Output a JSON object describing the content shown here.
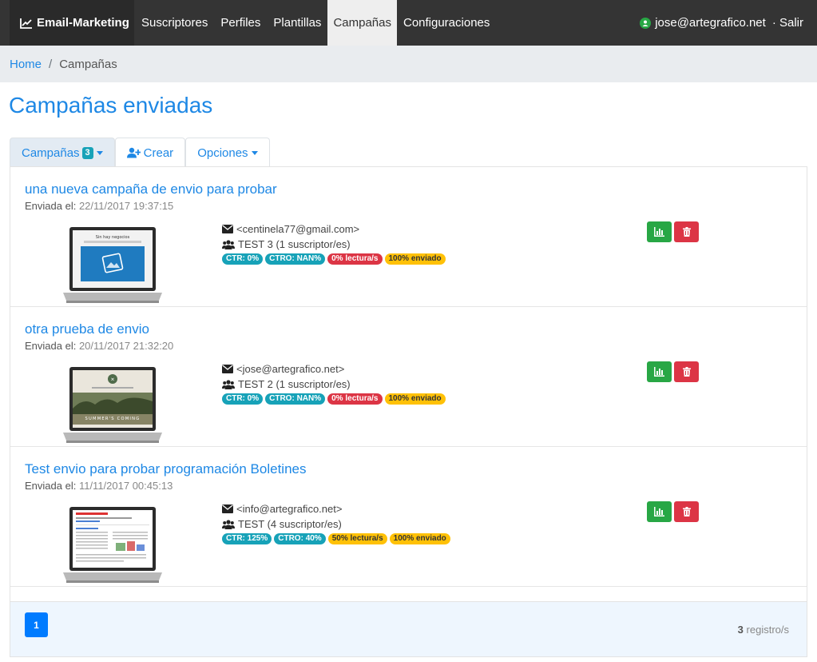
{
  "navbar": {
    "brand": "Email-Marketing",
    "items": [
      {
        "label": "Suscriptores"
      },
      {
        "label": "Perfiles"
      },
      {
        "label": "Plantillas"
      },
      {
        "label": "Campañas"
      },
      {
        "label": "Configuraciones"
      }
    ],
    "user_email": "jose@artegrafico.net",
    "logout_label": "· Salir"
  },
  "breadcrumb": {
    "home": "Home",
    "separator": "/",
    "current": "Campañas"
  },
  "page_title": "Campañas enviadas",
  "tabs": {
    "campaigns_label": "Campañas",
    "campaigns_count": "3",
    "create_label": "Crear",
    "options_label": "Opciones"
  },
  "campaigns": [
    {
      "title": "una nueva campaña de envio para probar",
      "date_label": "Enviada el:",
      "date": "22/11/2017 19:37:15",
      "email": "<centinela77@gmail.com>",
      "group": "TEST 3 (1 suscriptor/es)",
      "ctr": "CTR: 0%",
      "ctro": "CTRO: NAN%",
      "reading": "0% lectura/s",
      "sent": "100% enviado",
      "thumb_caption": "Sin hay negocios"
    },
    {
      "title": "otra prueba de envio",
      "date_label": "Enviada el:",
      "date": "20/11/2017 21:32:20",
      "email": "<jose@artegrafico.net>",
      "group": "TEST 2 (1 suscriptor/es)",
      "ctr": "CTR: 0%",
      "ctro": "CTRO: NAN%",
      "reading": "0% lectura/s",
      "sent": "100% enviado",
      "thumb_caption": "SUMMER'S COMING"
    },
    {
      "title": "Test envio para probar programación Boletines",
      "date_label": "Enviada el:",
      "date": "11/11/2017 00:45:13",
      "email": "<info@artegrafico.net>",
      "group": "TEST (4 suscriptor/es)",
      "ctr": "CTR: 125%",
      "ctro": "CTRO: 40%",
      "reading": "50% lectura/s",
      "sent": "100% enviado",
      "thumb_caption": ""
    }
  ],
  "pagination": {
    "current_page": "1",
    "records_count": "3",
    "records_label": "registro/s"
  },
  "colors": {
    "accent": "#1e88e5",
    "navbar": "#343434",
    "success": "#28a745",
    "danger": "#dc3545",
    "info": "#17a2b8",
    "warning": "#ffc107"
  }
}
